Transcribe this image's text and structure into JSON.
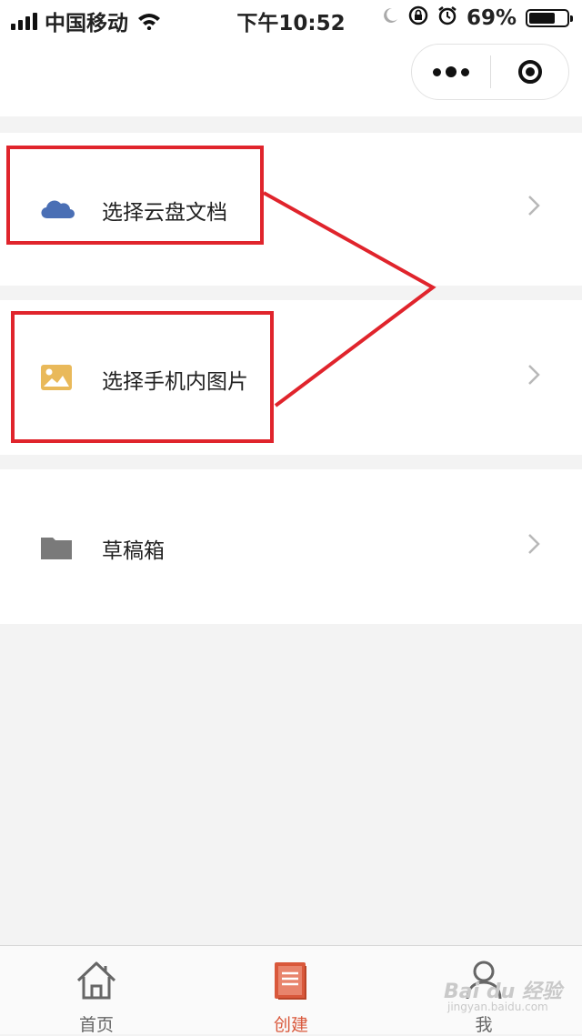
{
  "status_bar": {
    "carrier": "中国移动",
    "time": "下午10:52",
    "battery": "69%",
    "battery_level": 0.69
  },
  "menu": {
    "items": [
      {
        "label": "选择云盘文档",
        "icon": "cloud-icon",
        "icon_color": "#4a6fb5"
      },
      {
        "label": "选择手机内图片",
        "icon": "image-icon",
        "icon_color": "#e9b95a"
      },
      {
        "label": "草稿箱",
        "icon": "folder-icon",
        "icon_color": "#7a7a7a"
      }
    ]
  },
  "tabbar": {
    "tabs": [
      {
        "label": "首页",
        "icon": "home-icon",
        "active": false
      },
      {
        "label": "创建",
        "icon": "create-doc-icon",
        "active": true
      },
      {
        "label": "我",
        "icon": "user-icon",
        "active": false
      }
    ]
  },
  "watermark": {
    "text": "Bai du 经验",
    "sub": "jingyan.baidu.com"
  },
  "colors": {
    "accent": "#d9583b",
    "annotation": "#e0242c",
    "inactive": "#666666"
  }
}
